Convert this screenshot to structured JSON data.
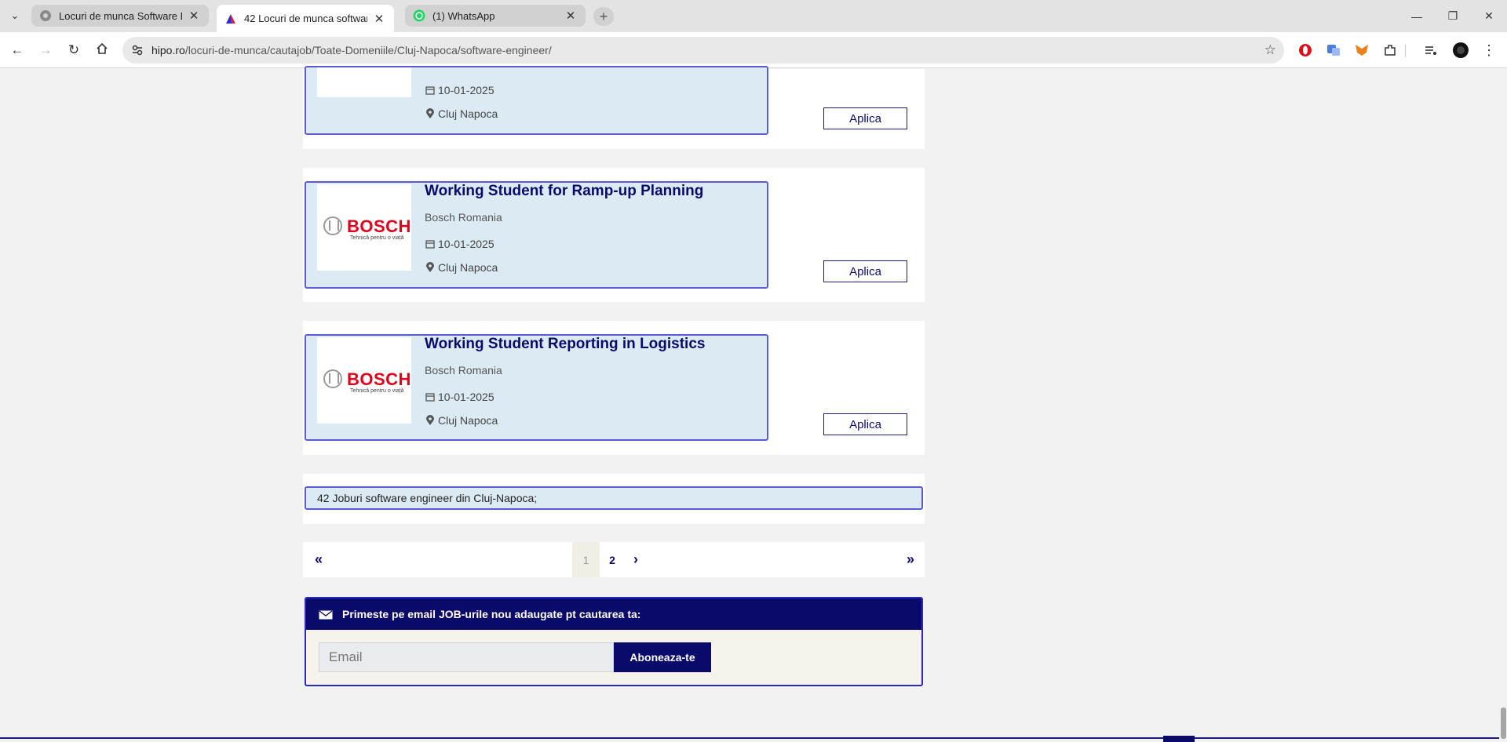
{
  "browser": {
    "tabs": [
      {
        "title": "Locuri de munca Software Engi",
        "active": false
      },
      {
        "title": "42 Locuri de munca software en",
        "active": true
      },
      {
        "title": "(1) WhatsApp",
        "active": false
      }
    ],
    "url_host": "hipo.ro",
    "url_path": "/locuri-de-munca/cautajob/Toate-Domeniile/Cluj-Napoca/software-engineer/"
  },
  "jobs": [
    {
      "title": "",
      "company": "",
      "date": "10-01-2025",
      "location": "Cluj Napoca",
      "apply_label": "Aplica",
      "logo": "partial"
    },
    {
      "title": "Working Student for Ramp-up Planning",
      "company": "Bosch Romania",
      "date": "10-01-2025",
      "location": "Cluj Napoca",
      "apply_label": "Aplica",
      "logo": "bosch"
    },
    {
      "title": "Working Student Reporting in Logistics",
      "company": "Bosch Romania",
      "date": "10-01-2025",
      "location": "Cluj Napoca",
      "apply_label": "Aplica",
      "logo": "bosch"
    }
  ],
  "logo": {
    "word": "BOSCH",
    "tagline": "Tehnică pentru o viață"
  },
  "results_summary": "42 Joburi software engineer din Cluj-Napoca;",
  "pagination": {
    "first": "«",
    "pages": [
      "1",
      "2"
    ],
    "current": "1",
    "next": "›",
    "last": "»"
  },
  "subscribe": {
    "heading": "Primeste pe email JOB-urile nou adaugate pt cautarea ta:",
    "email_placeholder": "Email",
    "button_label": "Aboneaza-te"
  },
  "colors": {
    "navy": "#0a0a6b",
    "card_bg": "#dcebf3",
    "card_border": "#5b5bd6",
    "bosch_red": "#e2001a"
  }
}
